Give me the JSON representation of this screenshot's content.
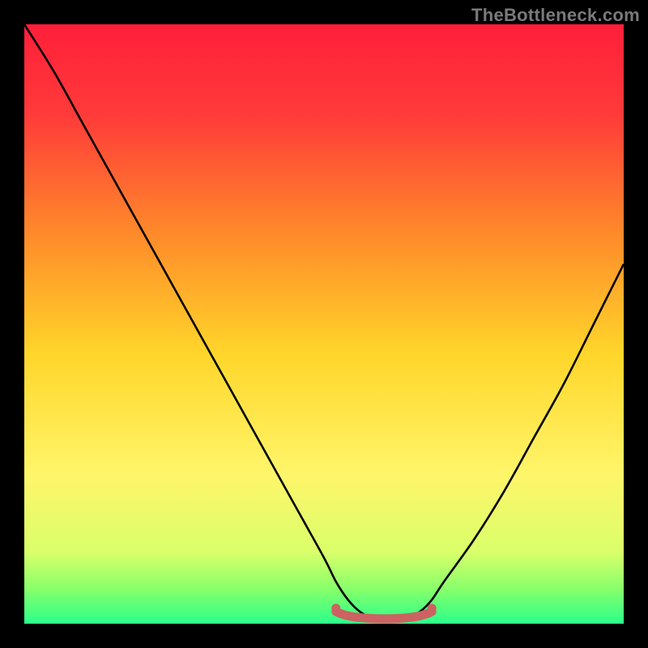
{
  "attribution": "TheBottleneck.com",
  "chart_data": {
    "type": "line",
    "title": "",
    "xlabel": "",
    "ylabel": "",
    "xlim": [
      0,
      100
    ],
    "ylim": [
      0,
      100
    ],
    "grid": false,
    "legend": false,
    "x": [
      0,
      5,
      10,
      15,
      20,
      25,
      30,
      35,
      40,
      45,
      50,
      52,
      54,
      56,
      58,
      60,
      62,
      64,
      66,
      68,
      70,
      75,
      80,
      85,
      90,
      95,
      100
    ],
    "values": [
      100,
      92,
      83,
      74,
      65,
      56,
      47,
      38,
      29,
      20,
      11,
      7,
      4,
      2,
      1,
      1,
      1,
      1,
      2,
      4,
      7,
      14,
      22,
      31,
      40,
      50,
      60
    ],
    "marked_range_x": [
      52,
      68
    ],
    "marked_y": 1.5,
    "background_gradient_stops": [
      {
        "offset": 0.0,
        "color": "#ff1f3a"
      },
      {
        "offset": 0.15,
        "color": "#ff3a3a"
      },
      {
        "offset": 0.35,
        "color": "#ff8a2a"
      },
      {
        "offset": 0.55,
        "color": "#ffd62a"
      },
      {
        "offset": 0.75,
        "color": "#fff56a"
      },
      {
        "offset": 0.88,
        "color": "#daff6a"
      },
      {
        "offset": 0.94,
        "color": "#8aff6a"
      },
      {
        "offset": 1.0,
        "color": "#2aff8a"
      }
    ],
    "curve_color": "#000000",
    "marked_color": "#cc6262"
  }
}
